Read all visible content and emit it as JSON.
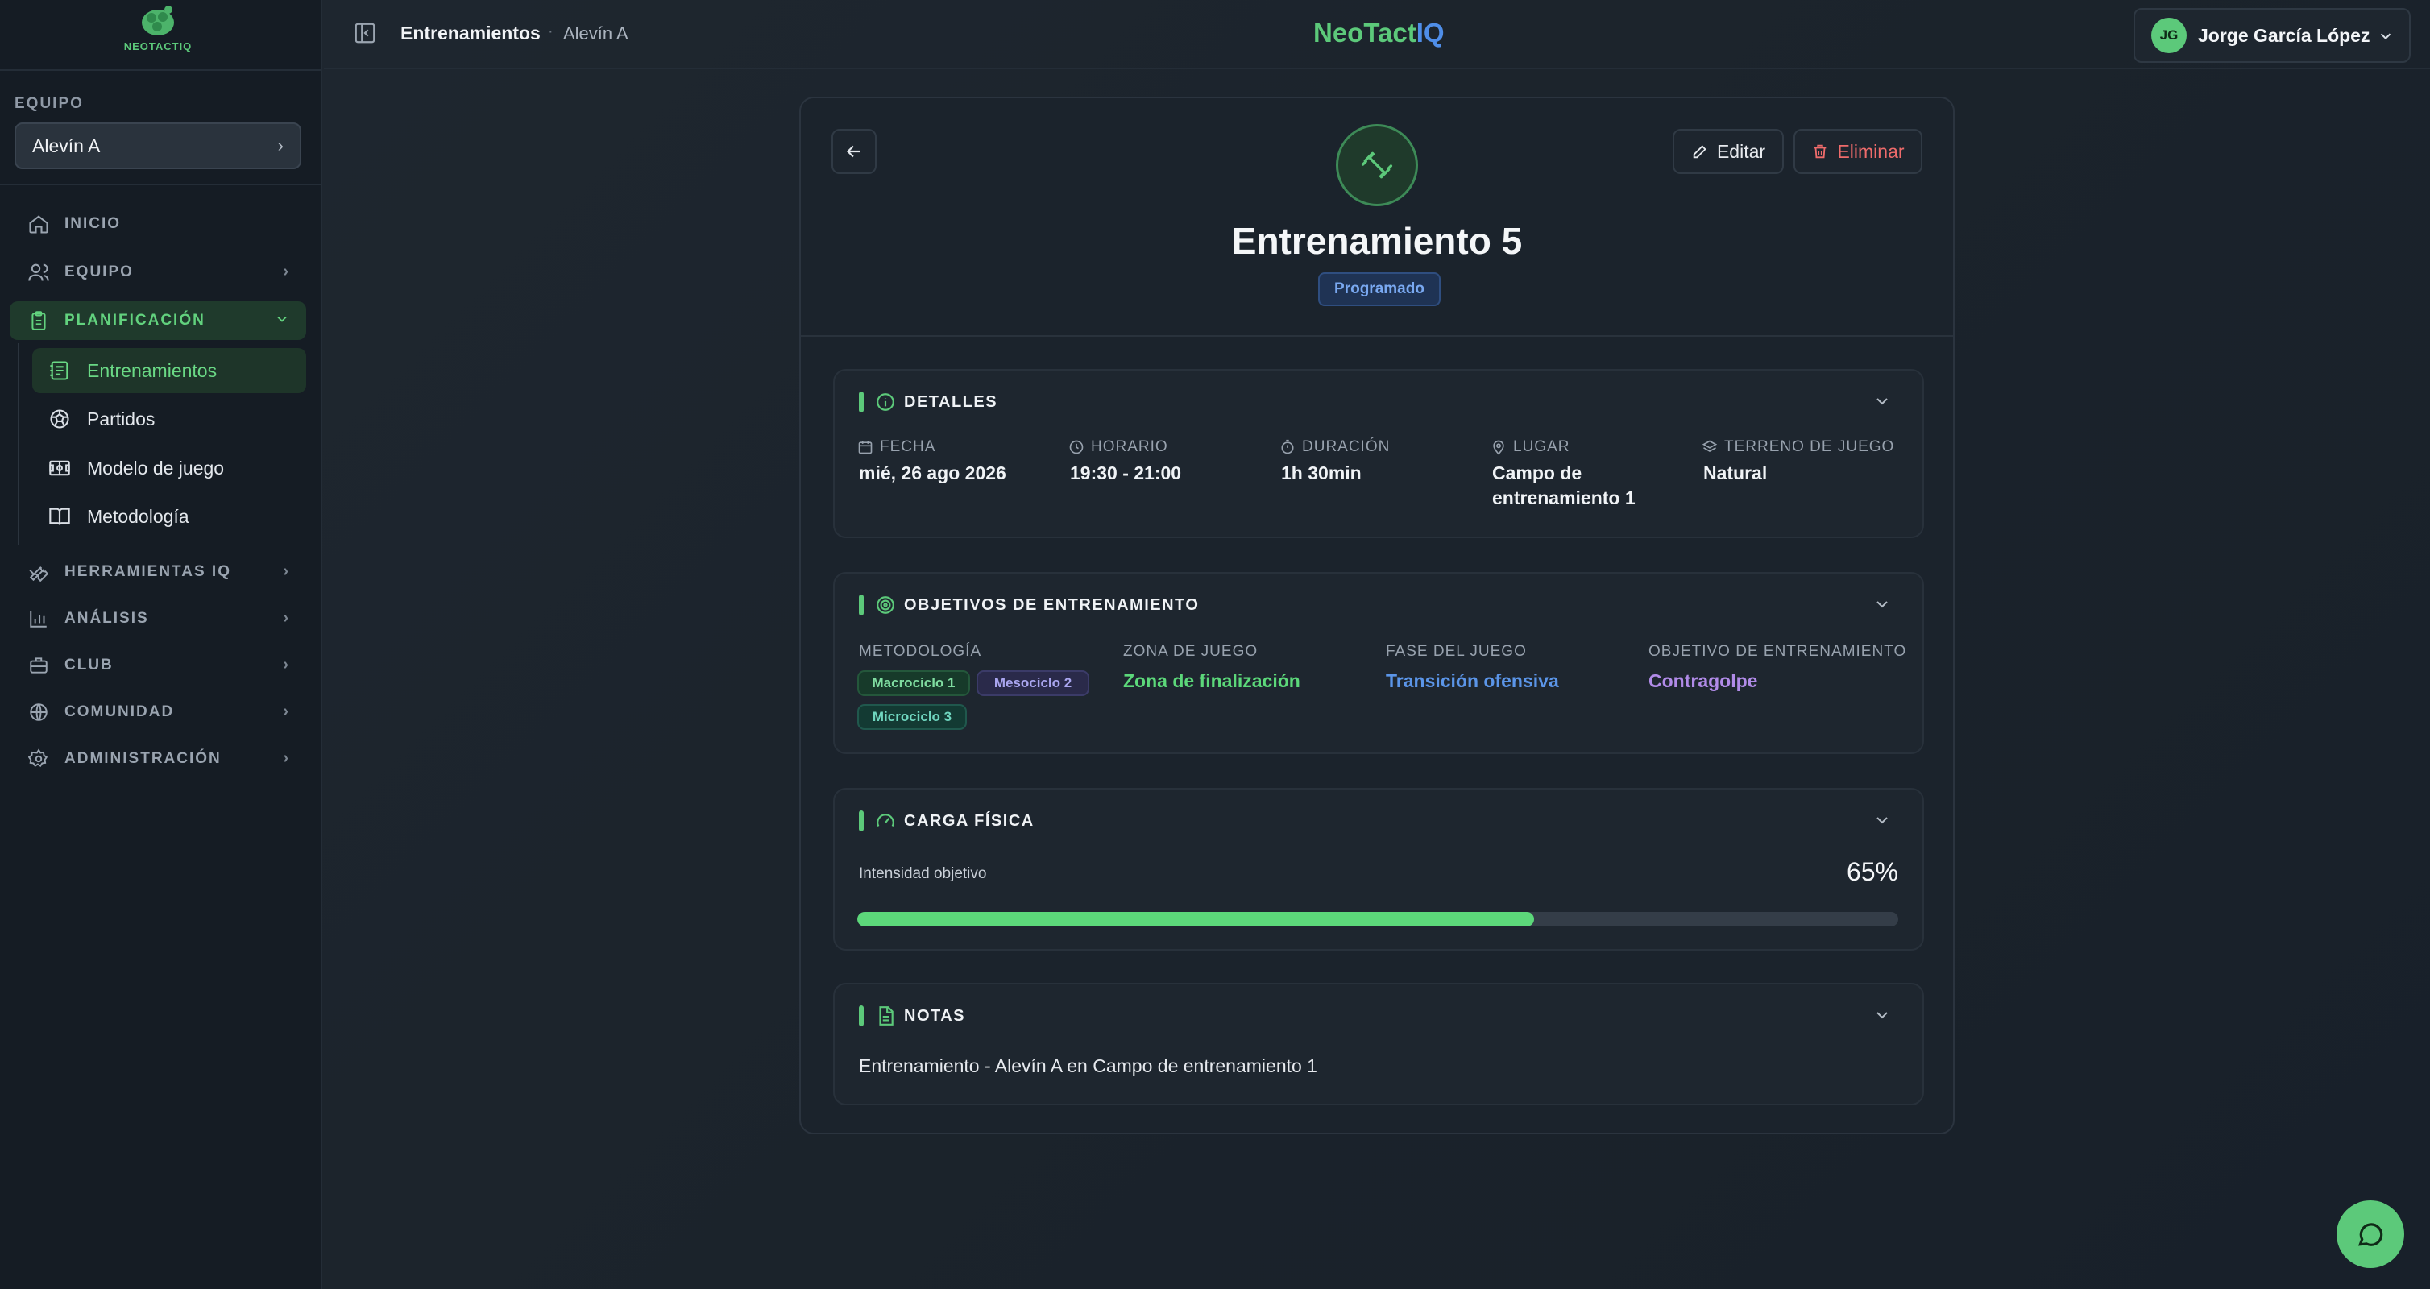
{
  "app": {
    "brand_neo": "NeoTact",
    "brand_iq": "IQ",
    "logo_text": "NEOTACTIQ"
  },
  "breadcrumb": {
    "main": "Entrenamientos",
    "sep": "·",
    "sub": "Alevín A"
  },
  "user": {
    "initials": "JG",
    "name": "Jorge García López"
  },
  "sidebar": {
    "team_label": "EQUIPO",
    "team_value": "Alevín A",
    "nav": [
      {
        "label": "INICIO",
        "icon": "home-icon"
      },
      {
        "label": "EQUIPO",
        "icon": "users-icon"
      },
      {
        "label": "PLANIFICACIÓN",
        "icon": "clipboard-icon"
      },
      {
        "label": "HERRAMIENTAS IQ",
        "icon": "wrench-icon"
      },
      {
        "label": "ANÁLISIS",
        "icon": "bar-chart-icon"
      },
      {
        "label": "CLUB",
        "icon": "briefcase-icon"
      },
      {
        "label": "COMUNIDAD",
        "icon": "globe-icon"
      },
      {
        "label": "ADMINISTRACIÓN",
        "icon": "settings-icon"
      }
    ],
    "sub": [
      {
        "label": "Entrenamientos",
        "icon": "notebook-icon"
      },
      {
        "label": "Partidos",
        "icon": "soccer-ball-icon"
      },
      {
        "label": "Modelo de juego",
        "icon": "tactics-board-icon"
      },
      {
        "label": "Metodología",
        "icon": "book-icon"
      }
    ]
  },
  "training": {
    "title": "Entrenamiento 5",
    "status": "Programado",
    "edit_label": "Editar",
    "delete_label": "Eliminar"
  },
  "details": {
    "title": "DETALLES",
    "fecha_label": "FECHA",
    "fecha": "mié, 26 ago 2026",
    "horario_label": "HORARIO",
    "horario": "19:30 - 21:00",
    "duracion_label": "DURACIÓN",
    "duracion": "1h 30min",
    "lugar_label": "LUGAR",
    "lugar_line1": "Campo de",
    "lugar_line2": "entrenamiento 1",
    "terreno_label": "TERRENO DE JUEGO",
    "terreno": "Natural"
  },
  "objectives": {
    "title": "OBJETIVOS DE ENTRENAMIENTO",
    "metodologia_label": "METODOLOGÍA",
    "tags": [
      "Macrociclo 1",
      "Mesociclo 2",
      "Microciclo 3"
    ],
    "zona_label": "ZONA DE JUEGO",
    "zona": "Zona de finalización",
    "fase_label": "FASE DEL JUEGO",
    "fase": "Transición ofensiva",
    "objetivo_label": "OBJETIVO DE ENTRENAMIENTO",
    "objetivo": "Contragolpe",
    "colors": {
      "zona": "#5cd87a",
      "fase": "#5b95e8",
      "objetivo": "#b18be8"
    }
  },
  "load": {
    "title": "CARGA FÍSICA",
    "label": "Intensidad objetivo",
    "value_text": "65%",
    "value": 65
  },
  "notes": {
    "title": "NOTAS",
    "text": "Entrenamiento - Alevín A en Campo de entrenamiento 1"
  }
}
